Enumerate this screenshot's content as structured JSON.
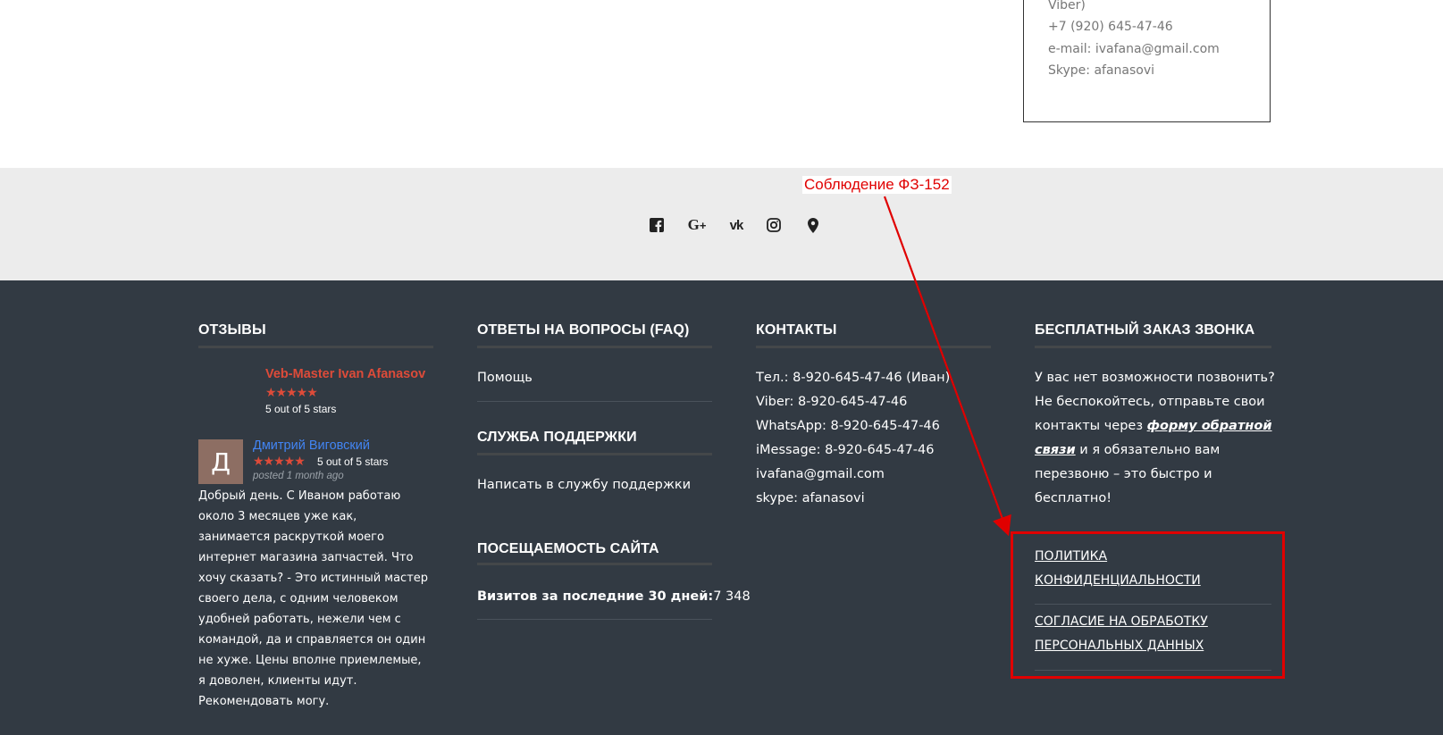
{
  "contact_box": {
    "lines": [
      "Viber)",
      "+7 (920) 645-47-46",
      "e-mail: ivafana@gmail.com",
      "Skype: afanasovi"
    ]
  },
  "social": {
    "icons": [
      "facebook-icon",
      "google-plus-icon",
      "vk-icon",
      "instagram-icon",
      "map-marker-icon"
    ]
  },
  "annotation": {
    "label": "Соблюдение ФЗ-152",
    "color": "#e00000"
  },
  "reviews": {
    "title": "ОТЗЫВЫ",
    "first": {
      "author": "Veb-Master Ivan Afanasov",
      "rating_text": "5 out of 5 stars",
      "rating": 5
    },
    "second": {
      "avatar_letter": "Д",
      "author": "Дмитрий Виговский",
      "rating_text": "5 out of 5 stars",
      "rating": 5,
      "posted": "posted 1 month ago",
      "text": "Добрый день. С Иваном работаю около 3 месяцев уже как, занимается раскруткой моего интернет магазина запчастей. Что хочу сказать? - Это истинный мастер своего дела, с одним человеком удобней работать, нежели чем с командой, да и справляется он один не хуже. Цены вполне приемлемые, я доволен, клиенты идут. Рекомендовать могу."
    }
  },
  "faq": {
    "title": "ОТВЕТЫ НА ВОПРОСЫ (FAQ)",
    "help_link": "Помощь",
    "support_title": "СЛУЖБА ПОДДЕРЖКИ",
    "support_link": "Написать в службу поддержки",
    "visits_title": "ПОСЕЩАЕМОСТЬ САЙТА",
    "visits_label": "Визитов за последние 30 дней:",
    "visits_value": "7 348"
  },
  "contacts": {
    "title": "КОНТАКТЫ",
    "lines": [
      "Тел.: 8-920-645-47-46 (Иван)",
      "Viber: 8-920-645-47-46",
      "WhatsApp: 8-920-645-47-46",
      "iMessage: 8-920-645-47-46",
      "ivafana@gmail.com",
      "skype: afanasovi"
    ]
  },
  "callback": {
    "title": "БЕСПЛАТНЫЙ ЗАКАЗ ЗВОНКА",
    "line1": "У вас нет возможности позвонить?",
    "line2": "Не беспокойтесь, отправьте свои",
    "line3_pre": "контакты через ",
    "line3_link": "форму обратной",
    "line4_link": "связи",
    "line4_post": " и я обязательно вам",
    "line5": "перезвоню – это быстро и",
    "line6": "бесплатно!",
    "policy1_a": "ПОЛИТИКА",
    "policy1_b": "КОНФИДЕНЦИАЛЬНОСТИ",
    "policy2_a": "СОГЛАСИЕ НА ОБРАБОТКУ",
    "policy2_b": "ПЕРСОНАЛЬНЫХ ДАННЫХ"
  }
}
